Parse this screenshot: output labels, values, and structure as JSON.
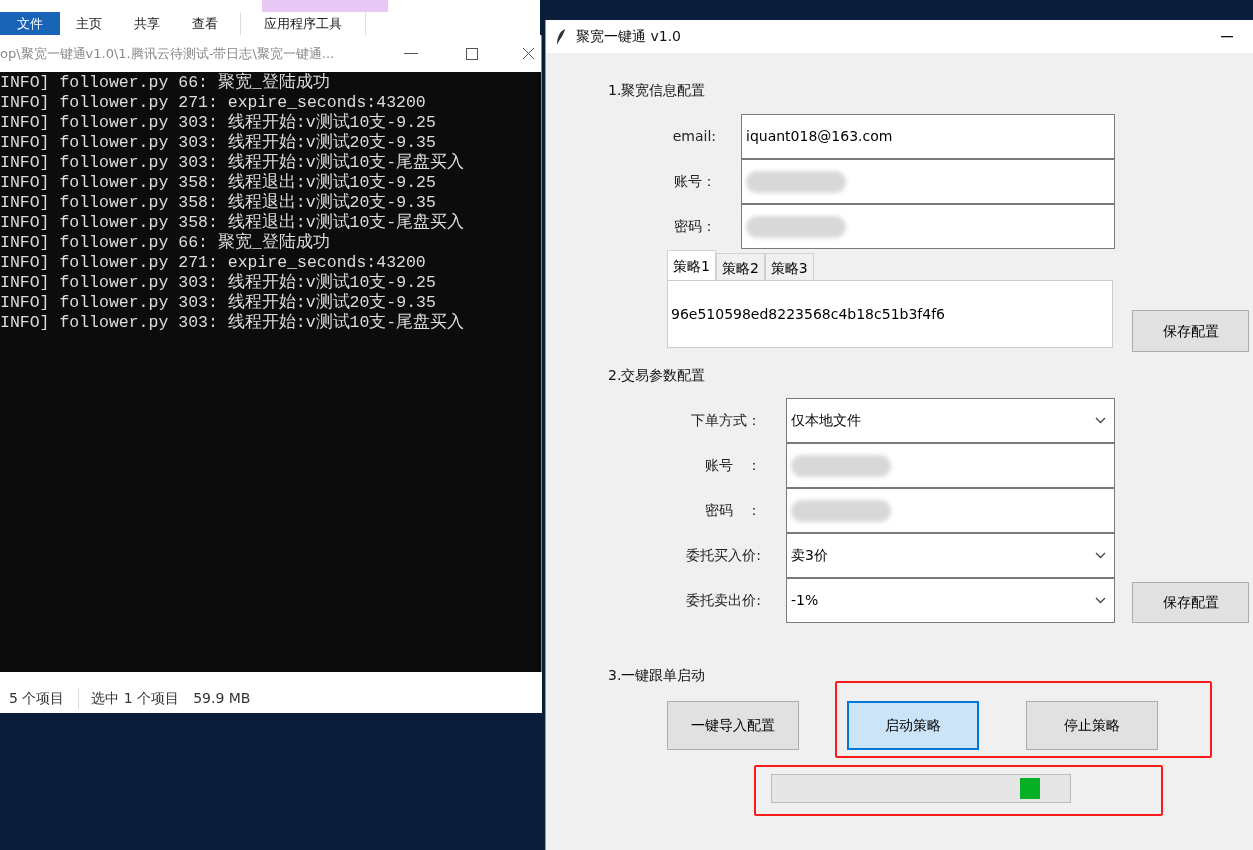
{
  "explorer": {
    "ribbon_tabs": [
      {
        "label": "文件",
        "selected": true
      },
      {
        "label": "主页",
        "selected": false
      },
      {
        "label": "共享",
        "selected": false
      },
      {
        "label": "查看",
        "selected": false
      },
      {
        "label": "应用程序工具",
        "selected": false
      }
    ],
    "status_bar": [
      "5 个项目",
      "选中 1 个项目",
      "59.9 MB"
    ]
  },
  "console": {
    "title": "op\\聚宽一键通v1.0\\1.腾讯云待测试-带日志\\聚宽一键通...",
    "lines": [
      "INFO] follower.py 66: 聚宽_登陆成功",
      "INFO] follower.py 271: expire_seconds:43200",
      "INFO] follower.py 303: 线程开始:v测试10支-9.25",
      "INFO] follower.py 303: 线程开始:v测试20支-9.35",
      "INFO] follower.py 303: 线程开始:v测试10支-尾盘买入",
      "INFO] follower.py 358: 线程退出:v测试10支-9.25",
      "INFO] follower.py 358: 线程退出:v测试20支-9.35",
      "INFO] follower.py 358: 线程退出:v测试10支-尾盘买入",
      "INFO] follower.py 66: 聚宽_登陆成功",
      "INFO] follower.py 271: expire_seconds:43200",
      "INFO] follower.py 303: 线程开始:v测试10支-9.25",
      "INFO] follower.py 303: 线程开始:v测试20支-9.35",
      "INFO] follower.py 303: 线程开始:v测试10支-尾盘买入"
    ]
  },
  "app": {
    "title": "聚宽一键通 v1.0",
    "section1": {
      "heading": "1.聚宽信息配置",
      "fields": [
        {
          "label": "email:",
          "value": "iquant018@163.com",
          "kind": "text"
        },
        {
          "label": "账号：",
          "kind": "blurred"
        },
        {
          "label": "密码：",
          "kind": "blurred"
        }
      ],
      "tabs": [
        {
          "label": "策略1",
          "selected": true
        },
        {
          "label": "策略2",
          "selected": false
        },
        {
          "label": "策略3",
          "selected": false
        }
      ],
      "strategy_value": "96e510598ed8223568c4b18c51b3f4f6",
      "save_button": "保存配置"
    },
    "section2": {
      "heading": "2.交易参数配置",
      "fields": [
        {
          "label": "下单方式：",
          "value": "仅本地文件",
          "kind": "select"
        },
        {
          "label": "账号　：",
          "kind": "blurred"
        },
        {
          "label": "密码　：",
          "kind": "blurred"
        },
        {
          "label": "委托买入价:",
          "value": "卖3价",
          "kind": "select"
        },
        {
          "label": "委托卖出价:",
          "value": "-1%",
          "kind": "select"
        }
      ],
      "save_button": "保存配置"
    },
    "section3": {
      "heading": "3.一键跟单启动",
      "buttons": [
        {
          "label": "一键导入配置",
          "selected": false
        },
        {
          "label": "启动策略",
          "selected": true
        },
        {
          "label": "停止策略",
          "selected": false
        }
      ],
      "progress": {
        "level": 0.9
      }
    }
  }
}
